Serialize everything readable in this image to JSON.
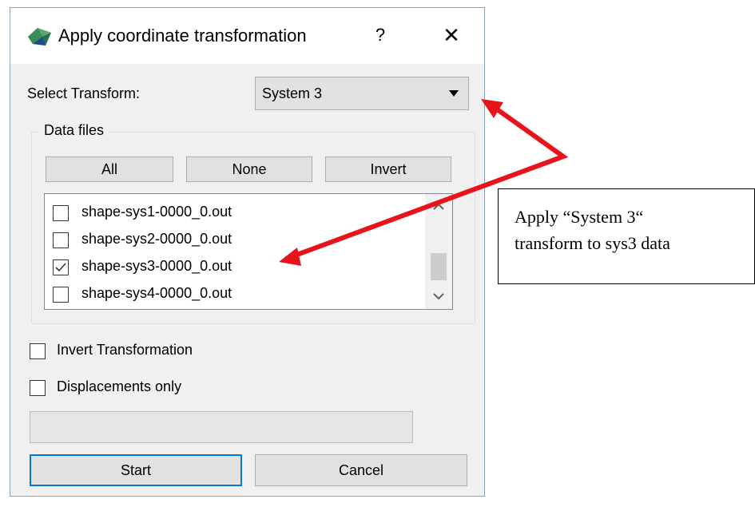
{
  "dialog": {
    "title": "Apply coordinate transformation",
    "help_label": "?",
    "close_label": "✕"
  },
  "transform": {
    "label": "Select Transform:",
    "selected": "System 3"
  },
  "data_files": {
    "group_title": "Data files",
    "buttons": {
      "all": "All",
      "none": "None",
      "invert": "Invert"
    },
    "items": [
      {
        "name": "shape-sys1-0000_0.out",
        "checked": false
      },
      {
        "name": "shape-sys2-0000_0.out",
        "checked": false
      },
      {
        "name": "shape-sys3-0000_0.out",
        "checked": true
      },
      {
        "name": "shape-sys4-0000_0.out",
        "checked": false
      }
    ]
  },
  "options": {
    "invert_transformation": {
      "label": "Invert Transformation",
      "checked": false
    },
    "displacements_only": {
      "label": "Displacements only",
      "checked": false
    }
  },
  "progress": {
    "value": 0
  },
  "actions": {
    "start": "Start",
    "cancel": "Cancel"
  },
  "annotation": {
    "text": "Apply “System 3“\ntransform to sys3 data",
    "arrow_color": "#e8141b"
  },
  "colors": {
    "accent": "#0078d7"
  }
}
